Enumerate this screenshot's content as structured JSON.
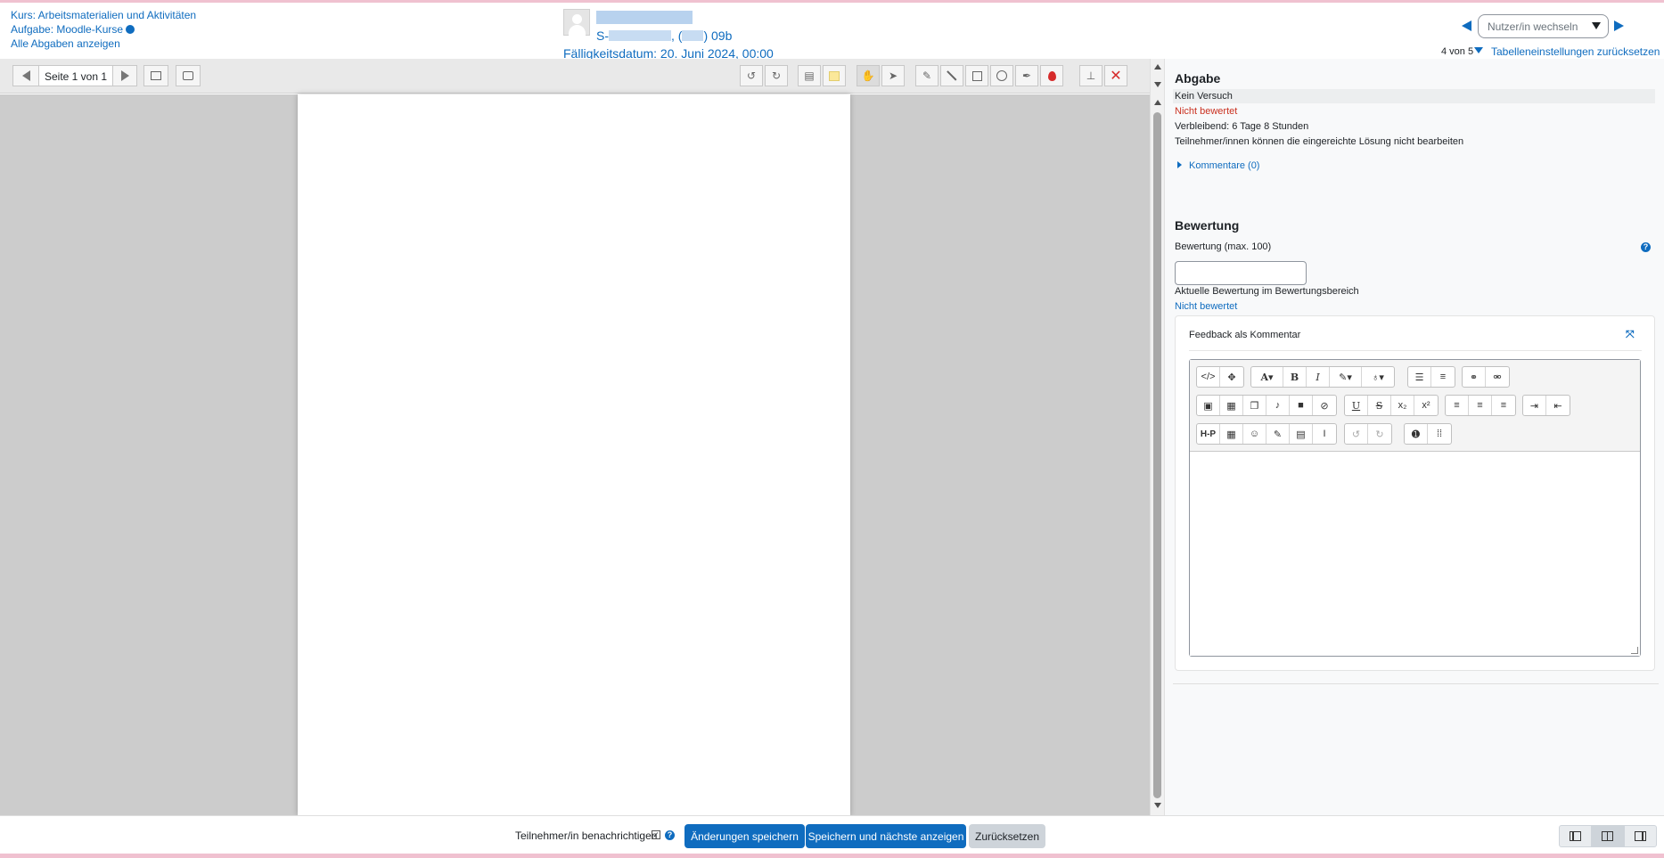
{
  "header": {
    "course_link": "Kurs: Arbeitsmaterialien und Aktivitäten",
    "assignment_link": "Aufgabe: Moodle-Kurse",
    "all_submissions_link": "Alle Abgaben anzeigen",
    "user_id_prefix": "S-",
    "user_id_mid": ", (",
    "user_id_suffix": ") 09b",
    "due_date": "Fälligkeitsdatum: 20. Juni 2024, 00:00",
    "user_select_placeholder": "Nutzer/in wechseln",
    "user_count": "4 von 5",
    "reset_table_link": "Tabelleneinstellungen zurücksetzen"
  },
  "pdf_toolbar": {
    "page_label": "Seite 1 von 1",
    "icons": [
      "previous-page-icon",
      "next-page-icon",
      "search-comments-icon",
      "expand-comments-icon",
      "rotate-left-icon",
      "rotate-right-icon",
      "comment-icon",
      "comment-color-icon",
      "pan-icon",
      "select-icon",
      "draw-icon",
      "line-icon",
      "rectangle-icon",
      "oval-icon",
      "highlight-icon",
      "annotation-color-icon",
      "stamp-icon",
      "delete-icon"
    ]
  },
  "panel": {
    "submission_heading": "Abgabe",
    "no_attempt": "Kein Versuch",
    "not_graded": "Nicht bewertet",
    "remaining": "Verbleibend: 6 Tage 8 Stunden",
    "cannot_edit": "Teilnehmer/innen können die eingereichte Lösung nicht bearbeiten",
    "comments_link": "Kommentare (0)",
    "grading_heading": "Bewertung",
    "grade_label": "Bewertung (max. 100)",
    "current_grade_label": "Aktuelle Bewertung im Bewertungsbereich",
    "current_grade_value": "Nicht bewertet",
    "feedback_title": "Feedback als Kommentar"
  },
  "footer": {
    "notify_label": "Teilnehmer/in benachrichtigen",
    "save_button": "Änderungen speichern",
    "save_next_button": "Speichern und nächste anzeigen",
    "reset_button": "Zurücksetzen"
  },
  "colors": {
    "link": "#0f6cbf",
    "danger": "#ca3120",
    "primary_button": "#0f6cbf"
  }
}
